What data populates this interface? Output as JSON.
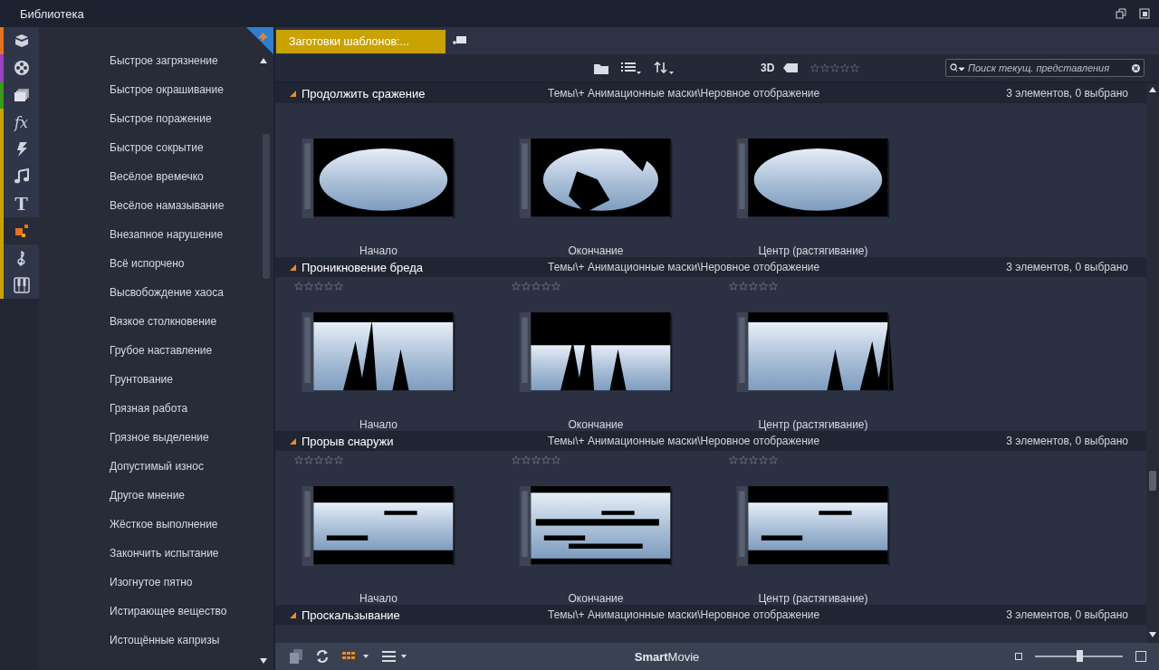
{
  "window": {
    "title": "Библиотека"
  },
  "rail": [
    {
      "kind": "icon",
      "color": "#e8731c",
      "selected": false
    },
    {
      "kind": "icon",
      "color": "#9b3fc4",
      "selected": false
    },
    {
      "kind": "icon",
      "color": "#3a9a1c",
      "selected": false
    },
    {
      "kind": "glyph",
      "label": "fx",
      "color": "#c9a200",
      "selected": false
    },
    {
      "kind": "icon",
      "color": "#c9a200",
      "selected": false
    },
    {
      "kind": "icon",
      "color": "#c9a200",
      "selected": false
    },
    {
      "kind": "glyph",
      "label": "T",
      "color": "#c9a200",
      "selected": false
    },
    {
      "kind": "icon",
      "color": "#c9a200",
      "selected": true
    },
    {
      "kind": "icon",
      "color": "#c9a200",
      "selected": false
    },
    {
      "kind": "icon",
      "color": "#c9a200",
      "selected": false
    }
  ],
  "list": {
    "items": [
      "Быстрое загрязнение",
      "Быстрое окрашивание",
      "Быстрое поражение",
      "Быстрое сокрытие",
      "Весёлое времечко",
      "Весёлое намазывание",
      "Внезапное нарушение",
      "Всё испорчено",
      "Высвобождение хаоса",
      "Вязкое столкновение",
      "Грубое наставление",
      "Грунтование",
      "Грязная работа",
      "Грязное выделение",
      "Допустимый износ",
      "Другое мнение",
      "Жёсткое выполнение",
      "Закончить испытание",
      "Изогнутое пятно",
      "Истирающее вещество",
      "Истощённые капризы"
    ]
  },
  "tabs": [
    {
      "label": "Заготовки шаблонов:...",
      "selected": true
    }
  ],
  "toolbar": {
    "mode_label": "3D",
    "rating_filter": {
      "stars": 0
    },
    "search": {
      "placeholder": "Поиск текущ. представления"
    }
  },
  "groups": [
    {
      "title": "Продолжить сражение",
      "path": "Темы\\+ Анимационные маски\\Неровное отображение",
      "count": "3 элементов, 0 выбрано",
      "expanded": true,
      "items": [
        {
          "label": "Начало"
        },
        {
          "label": "Окончание"
        },
        {
          "label": "Центр (растягивание)"
        }
      ]
    },
    {
      "title": "Проникновение бреда",
      "path": "Темы\\+ Анимационные маски\\Неровное отображение",
      "count": "3 элементов, 0 выбрано",
      "expanded": true,
      "items": [
        {
          "label": "Начало",
          "stars": 0
        },
        {
          "label": "Окончание",
          "stars": 0
        },
        {
          "label": "Центр (растягивание)",
          "stars": 0
        }
      ]
    },
    {
      "title": "Прорыв снаружи",
      "path": "Темы\\+ Анимационные маски\\Неровное отображение",
      "count": "3 элементов, 0 выбрано",
      "expanded": true,
      "items": [
        {
          "label": "Начало",
          "stars": 0
        },
        {
          "label": "Окончание",
          "stars": 0
        },
        {
          "label": "Центр (растягивание)",
          "stars": 0
        }
      ]
    },
    {
      "title": "Проскальзывание",
      "path": "Темы\\+ Анимационные маски\\Неровное отображение",
      "count": "3 элементов, 0 выбрано",
      "expanded": true
    }
  ],
  "status_bar": {
    "brand": "**Smart**Movie",
    "zoom": {
      "level": 0.5
    }
  }
}
